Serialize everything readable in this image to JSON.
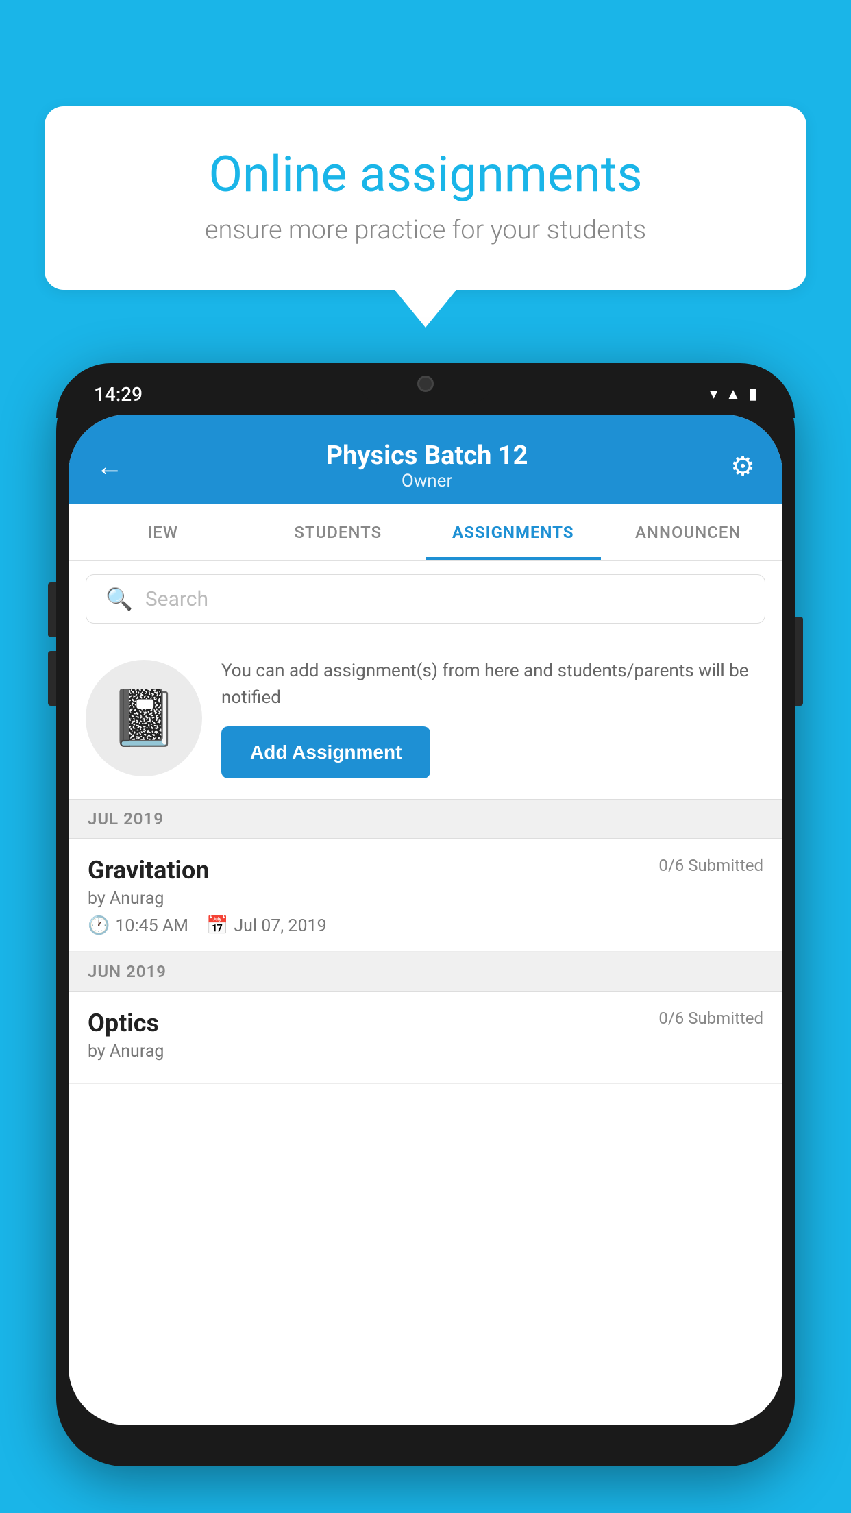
{
  "background_color": "#1ab5e8",
  "speech_bubble": {
    "title": "Online assignments",
    "subtitle": "ensure more practice for your students"
  },
  "phone": {
    "status_bar": {
      "time": "14:29"
    },
    "header": {
      "title": "Physics Batch 12",
      "subtitle": "Owner"
    },
    "tabs": [
      {
        "label": "IEW",
        "active": false
      },
      {
        "label": "STUDENTS",
        "active": false
      },
      {
        "label": "ASSIGNMENTS",
        "active": true
      },
      {
        "label": "ANNOUNCEN",
        "active": false
      }
    ],
    "search": {
      "placeholder": "Search"
    },
    "info_section": {
      "description": "You can add assignment(s) from here and students/parents will be notified",
      "button_label": "Add Assignment"
    },
    "assignment_groups": [
      {
        "month": "JUL 2019",
        "assignments": [
          {
            "title": "Gravitation",
            "submitted": "0/6 Submitted",
            "by": "by Anurag",
            "time": "10:45 AM",
            "date": "Jul 07, 2019"
          }
        ]
      },
      {
        "month": "JUN 2019",
        "assignments": [
          {
            "title": "Optics",
            "submitted": "0/6 Submitted",
            "by": "by Anurag",
            "time": "",
            "date": ""
          }
        ]
      }
    ]
  }
}
